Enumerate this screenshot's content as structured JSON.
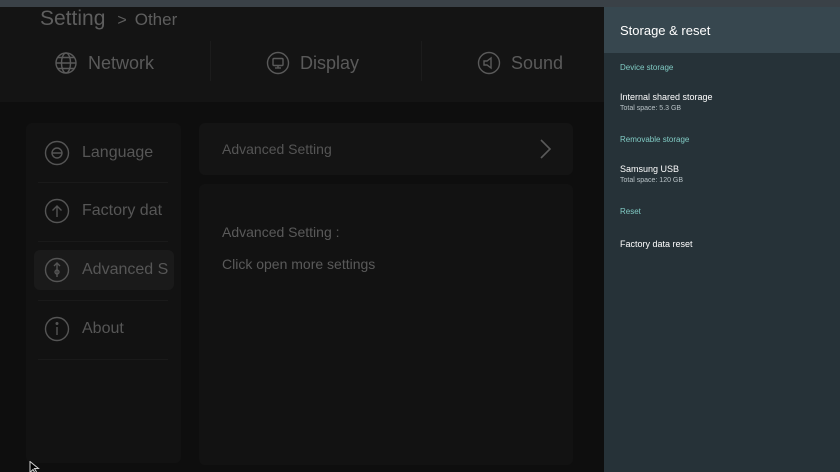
{
  "background_app": {
    "breadcrumb": {
      "main": "Setting",
      "separator": ">",
      "sub": "Other"
    },
    "top_nav": [
      {
        "label": "Network",
        "icon": "globe-icon"
      },
      {
        "label": "Display",
        "icon": "display-icon"
      },
      {
        "label": "Sound",
        "icon": "speaker-icon"
      }
    ],
    "sidebar": [
      {
        "label": "Language",
        "icon": "language-icon"
      },
      {
        "label": "Factory dat",
        "icon": "upload-icon"
      },
      {
        "label": "Advanced S",
        "icon": "advanced-icon",
        "active": true
      },
      {
        "label": "About",
        "icon": "info-icon"
      }
    ],
    "advanced_row": {
      "label": "Advanced Setting"
    },
    "advanced_panel": {
      "title": "Advanced Setting :",
      "description": "Click open more settings"
    }
  },
  "storage_panel": {
    "title": "Storage & reset",
    "sections": {
      "device": {
        "label": "Device storage",
        "items": [
          {
            "title": "Internal shared storage",
            "subtitle": "Total space: 5.3 GB"
          }
        ]
      },
      "removable": {
        "label": "Removable storage",
        "items": [
          {
            "title": "Samsung USB",
            "subtitle": "Total space: 120 GB"
          }
        ]
      },
      "reset": {
        "label": "Reset",
        "items": [
          {
            "title": "Factory data reset"
          }
        ]
      }
    }
  },
  "colors": {
    "panel_bg": "#263238",
    "panel_header_bg": "#37474f",
    "section_accent": "#80cbc4"
  }
}
